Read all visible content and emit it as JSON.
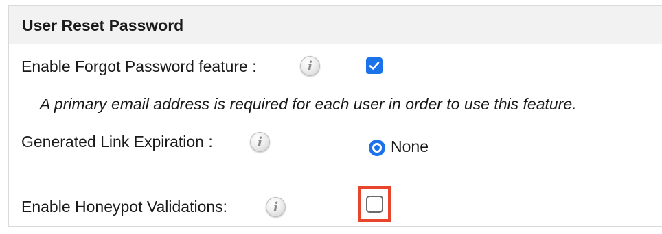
{
  "section": {
    "title": "User Reset Password"
  },
  "fields": {
    "forgot_password": {
      "label": "Enable Forgot Password feature :",
      "info_icon": "info-icon",
      "checked": true,
      "note": "A primary email address is required for each user in order to use this feature."
    },
    "link_expiration": {
      "label": "Generated Link Expiration :",
      "info_icon": "info-icon",
      "option_label": "None",
      "selected": true
    },
    "honeypot": {
      "label": "Enable Honeypot Validations:",
      "info_icon": "info-icon",
      "checked": false
    }
  },
  "colors": {
    "accent": "#1a73e8",
    "highlight": "#e8452c",
    "header_bg": "#f2f2f2"
  }
}
